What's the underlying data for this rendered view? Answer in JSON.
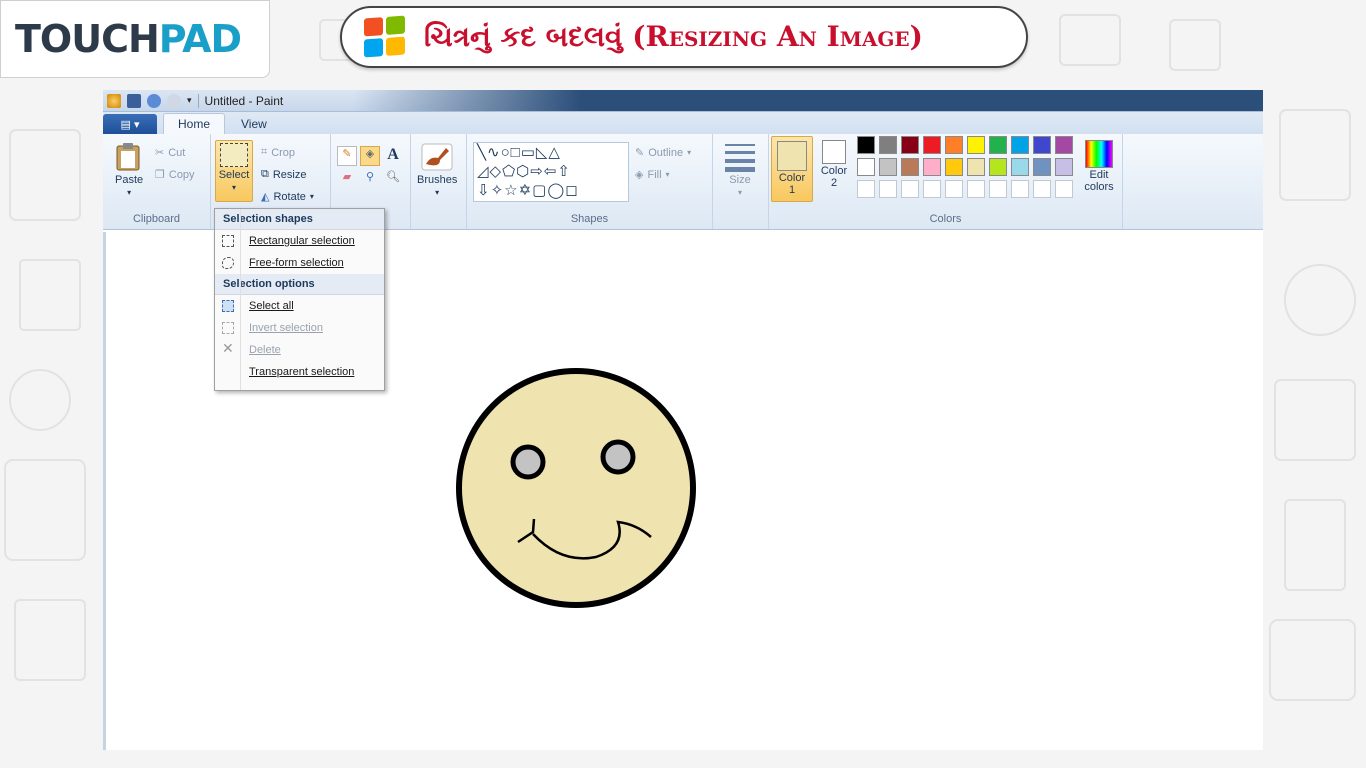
{
  "logo": {
    "part1": "TOUCH",
    "part2": "PAD"
  },
  "banner": {
    "title": "ચિત્રનું કદ બદલવું (Resizing An Image)"
  },
  "window": {
    "title": "Untitled - Paint"
  },
  "tabs": [
    "Home",
    "View"
  ],
  "clipboard": {
    "paste": "Paste",
    "cut": "Cut",
    "copy": "Copy",
    "label": "Clipboard"
  },
  "image": {
    "select": "Select",
    "crop": "Crop",
    "resize": "Resize",
    "rotate": "Rotate"
  },
  "tools": {
    "text_tool": "A"
  },
  "brushes": {
    "label": "Brushes"
  },
  "shapes": {
    "outline": "Outline",
    "fill": "Fill",
    "label": "Shapes"
  },
  "size": {
    "label": "Size"
  },
  "colors": {
    "color1": "Color 1",
    "color2": "Color 2",
    "edit": "Edit colors",
    "label": "Colors",
    "palette_row1": [
      "#000000",
      "#7f7f7f",
      "#880015",
      "#ed1c24",
      "#ff7f27",
      "#fff200",
      "#22b14c",
      "#00a2e8",
      "#3f48cc",
      "#a349a4"
    ],
    "palette_row2": [
      "#ffffff",
      "#c3c3c3",
      "#b97a57",
      "#ffaec9",
      "#ffc90e",
      "#efe4b0",
      "#b5e61d",
      "#99d9ea",
      "#7092be",
      "#c8bfe7"
    ],
    "color1_value": "#efe4b0",
    "color2_value": "#ffffff"
  },
  "dropdown": {
    "shapes_header": "Selection shapes",
    "rect": "Rectangular selection",
    "freeform": "Free-form selection",
    "options_header": "Selection options",
    "select_all": "Select all",
    "invert": "Invert selection",
    "delete": "Delete",
    "transparent": "Transparent selection"
  },
  "drawing": {
    "face_color": "#efe4b0",
    "eye_color": "#c3c3c3"
  }
}
